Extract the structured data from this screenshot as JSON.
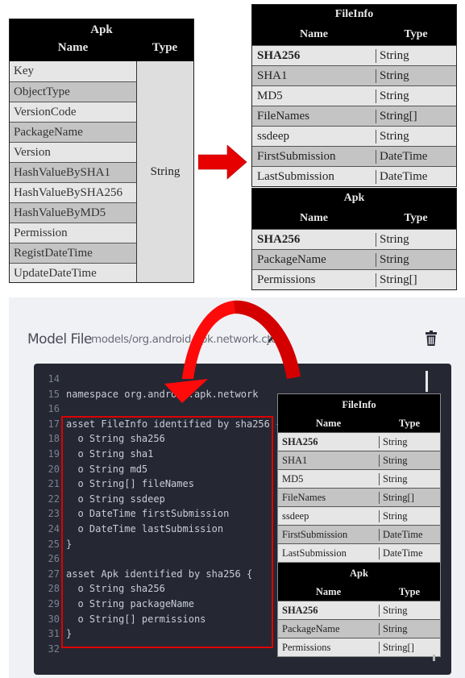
{
  "left_table": {
    "title": "Apk",
    "col_name": "Name",
    "col_type": "Type",
    "rows": [
      "Key",
      "ObjectType",
      "VersionCode",
      "PackageName",
      "Version",
      "HashValueBySHA1",
      "HashValueBySHA256",
      "HashValueByMD5",
      "Permission",
      "RegistDateTime",
      "UpdateDateTime"
    ],
    "type_value": "String"
  },
  "fileinfo_table": {
    "title": "FileInfo",
    "col_name": "Name",
    "col_type": "Type",
    "rows": [
      {
        "name": "SHA256",
        "type": "String",
        "key": true
      },
      {
        "name": "SHA1",
        "type": "String"
      },
      {
        "name": "MD5",
        "type": "String"
      },
      {
        "name": "FileNames",
        "type": "String[]"
      },
      {
        "name": "ssdeep",
        "type": "String"
      },
      {
        "name": "FirstSubmission",
        "type": "DateTime"
      },
      {
        "name": "LastSubmission",
        "type": "DateTime"
      }
    ]
  },
  "apk_table": {
    "title": "Apk",
    "col_name": "Name",
    "col_type": "Type",
    "rows": [
      {
        "name": "SHA256",
        "type": "String",
        "key": true
      },
      {
        "name": "PackageName",
        "type": "String"
      },
      {
        "name": "Permissions",
        "type": "String[]"
      }
    ]
  },
  "model_file": {
    "title": "Model File",
    "path": "models/org.android.apk.network.cto",
    "edit_icon": "pencil-icon",
    "delete_icon": "trash-icon"
  },
  "code": [
    {
      "ln": "14",
      "text": ""
    },
    {
      "ln": "15",
      "text": "namespace org.android.apk.network"
    },
    {
      "ln": "16",
      "text": ""
    },
    {
      "ln": "17",
      "text": "asset FileInfo identified by sha256 {"
    },
    {
      "ln": "18",
      "text": "  o String sha256"
    },
    {
      "ln": "19",
      "text": "  o String sha1"
    },
    {
      "ln": "20",
      "text": "  o String md5"
    },
    {
      "ln": "21",
      "text": "  o String[] fileNames"
    },
    {
      "ln": "22",
      "text": "  o String ssdeep"
    },
    {
      "ln": "23",
      "text": "  o DateTime firstSubmission"
    },
    {
      "ln": "24",
      "text": "  o DateTime lastSubmission"
    },
    {
      "ln": "25",
      "text": "}"
    },
    {
      "ln": "26",
      "text": ""
    },
    {
      "ln": "27",
      "text": "asset Apk identified by sha256 {"
    },
    {
      "ln": "28",
      "text": "  o String sha256"
    },
    {
      "ln": "29",
      "text": "  o String packageName"
    },
    {
      "ln": "30",
      "text": "  o String[] permissions"
    },
    {
      "ln": "31",
      "text": "}"
    },
    {
      "ln": "32",
      "text": ""
    }
  ],
  "colors": {
    "arrow": "#e60000",
    "key_field": "#1e9ae0",
    "editor_bg": "#252833",
    "highlight": "#e00000"
  }
}
